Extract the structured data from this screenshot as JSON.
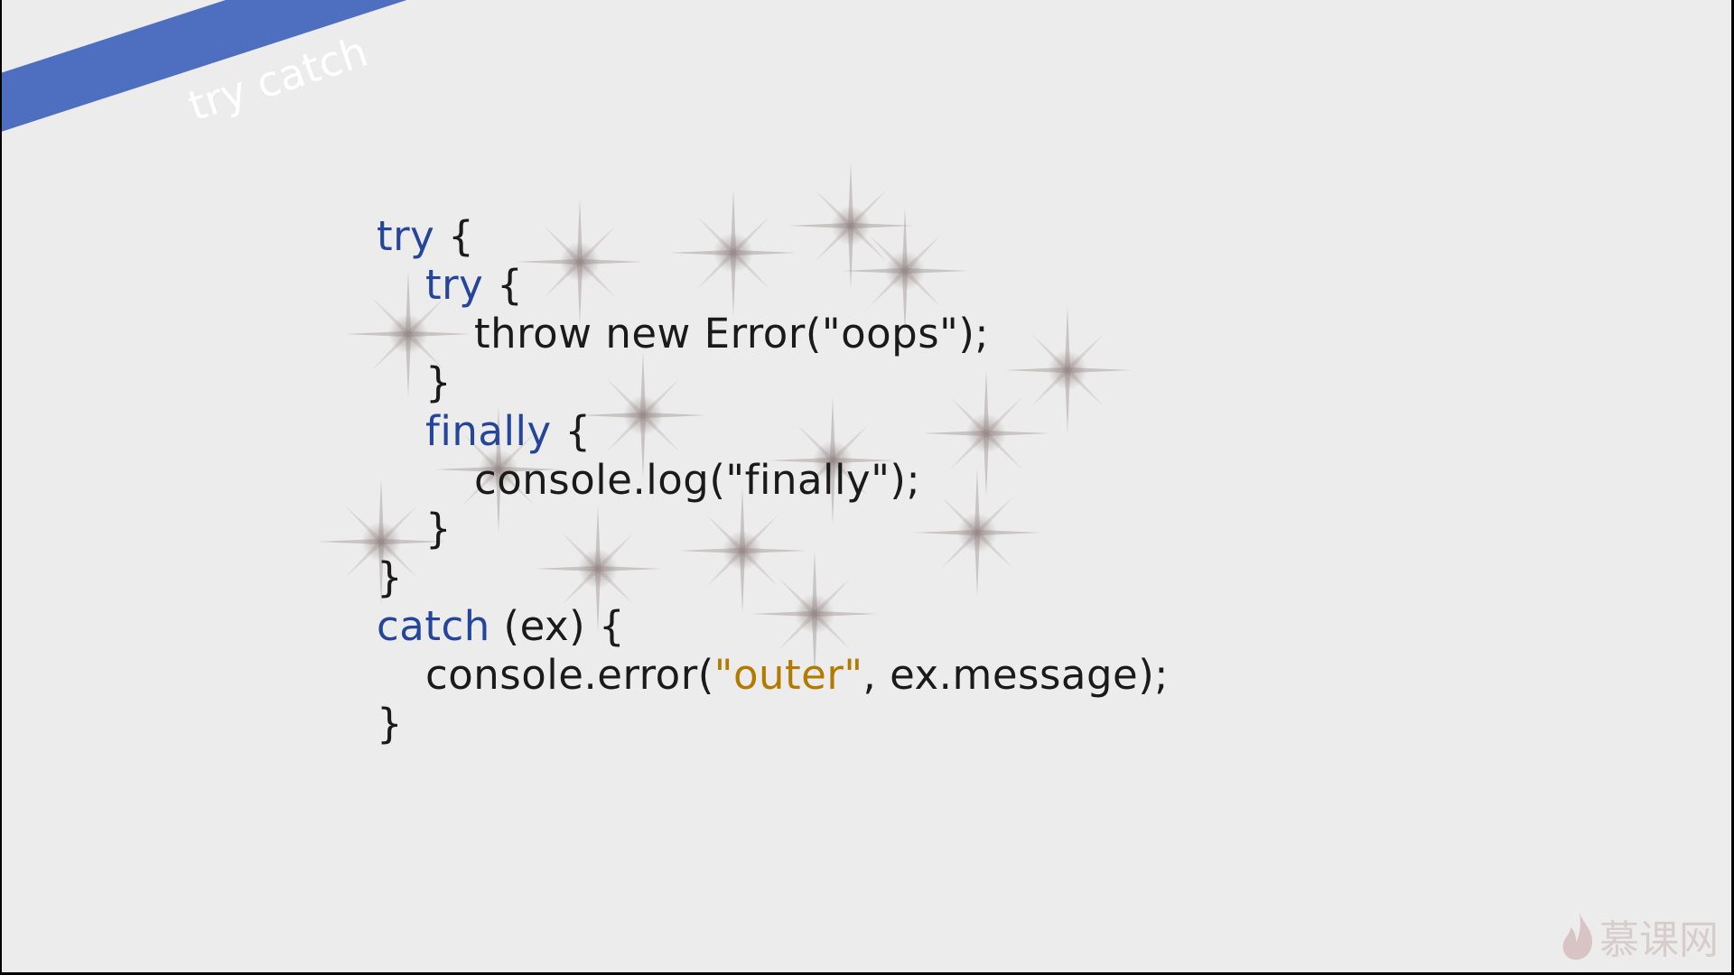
{
  "slide": {
    "title": "try catch",
    "code": {
      "line1_kw": "try",
      "line1_rest": " {",
      "line2_kw": "try",
      "line2_rest": " {",
      "line3": "throw new Error(\"oops\");",
      "line4": "}",
      "line5_kw": "finally",
      "line5_rest": " {",
      "line6": "console.log(\"finally\");",
      "line7": "}",
      "line8": "}",
      "line9_kw": "catch",
      "line9_rest": " (ex) {",
      "line10_pre": "console.error(",
      "line10_str": "\"outer\"",
      "line10_post": ", ex.message);",
      "line11": "}"
    }
  },
  "watermark": {
    "icon": "flame-icon",
    "text": "慕课网"
  },
  "colors": {
    "banner": "#4e6fc0",
    "keyword": "#25459a",
    "string": "#b47a00",
    "background": "#ececec"
  }
}
